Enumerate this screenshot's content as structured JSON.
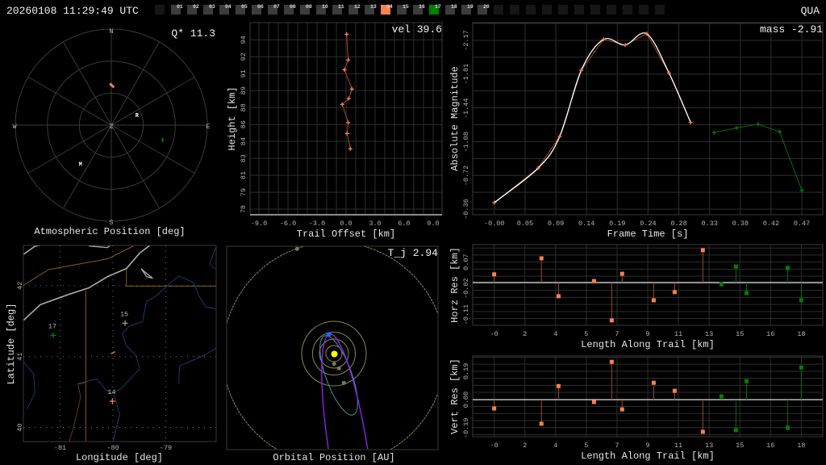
{
  "header": {
    "timestamp": "20260108 11:29:49 UTC",
    "station": "QUA"
  },
  "colors": {
    "primary": "#ff7f50",
    "secondary": "#008000",
    "grey_marker": "#9a9a9a",
    "fit": "#ffffff",
    "slot_idle": "#3c3c3c",
    "slot_off": "#161616"
  },
  "camera_slots": [
    {
      "label": "",
      "state": "off"
    },
    {
      "label": "01",
      "state": "idle"
    },
    {
      "label": "02",
      "state": "idle"
    },
    {
      "label": "03",
      "state": "idle"
    },
    {
      "label": "04",
      "state": "idle"
    },
    {
      "label": "05",
      "state": "idle"
    },
    {
      "label": "06",
      "state": "idle"
    },
    {
      "label": "07",
      "state": "idle"
    },
    {
      "label": "08",
      "state": "idle"
    },
    {
      "label": "09",
      "state": "idle"
    },
    {
      "label": "10",
      "state": "idle"
    },
    {
      "label": "11",
      "state": "idle"
    },
    {
      "label": "12",
      "state": "idle"
    },
    {
      "label": "13",
      "state": "idle"
    },
    {
      "label": "14",
      "state": "primary"
    },
    {
      "label": "15",
      "state": "idle"
    },
    {
      "label": "16",
      "state": "idle"
    },
    {
      "label": "17",
      "state": "secondary"
    },
    {
      "label": "18",
      "state": "idle"
    },
    {
      "label": "19",
      "state": "idle"
    },
    {
      "label": "20",
      "state": "idle"
    },
    {
      "label": "",
      "state": "off"
    },
    {
      "label": "",
      "state": "off"
    },
    {
      "label": "",
      "state": "off"
    },
    {
      "label": "",
      "state": "off"
    },
    {
      "label": "",
      "state": "off"
    },
    {
      "label": "",
      "state": "off"
    },
    {
      "label": "",
      "state": "off"
    },
    {
      "label": "",
      "state": "off"
    },
    {
      "label": "",
      "state": "off"
    },
    {
      "label": "",
      "state": "off"
    },
    {
      "label": "",
      "state": "off"
    }
  ],
  "polar": {
    "title": "Atmospheric Position [deg]",
    "stat": "Q* 11.3",
    "dirs": {
      "n": "N",
      "s": "S",
      "e": "E",
      "w": "W",
      "z": "Z"
    },
    "rings_deg": [
      30,
      60,
      90
    ],
    "markers": [
      {
        "label": "R",
        "az": 68,
        "zen": 26
      },
      {
        "label": "M",
        "az": 219,
        "zen": 46
      }
    ],
    "secondary_point": {
      "az": 106,
      "zen": 50
    },
    "primary_track": {
      "start": {
        "az": 358,
        "zen": 39
      },
      "end": {
        "az": 4,
        "zen": 35.5
      }
    }
  },
  "map": {
    "xlabel": "Longitude [deg]",
    "ylabel": "Latitude [deg]",
    "lon_ticks": {
      "values": [
        -81,
        -80,
        -79
      ],
      "labels": [
        "-81",
        "-80",
        "-79"
      ]
    },
    "lat_ticks": {
      "values": [
        42,
        41,
        40
      ],
      "labels": [
        "42",
        "41",
        "40"
      ]
    },
    "stations": [
      {
        "label": "17",
        "lon": -81.13,
        "lat": 41.3,
        "kind": "secondary"
      },
      {
        "label": "15",
        "lon": -79.77,
        "lat": 41.47,
        "kind": "grey"
      },
      {
        "label": "14",
        "lon": -80.01,
        "lat": 40.37,
        "kind": "primary"
      }
    ],
    "track": {
      "start": {
        "lon": -80.04,
        "lat": 41.04
      },
      "end": {
        "lon": -79.96,
        "lat": 41.07
      }
    }
  },
  "orbit": {
    "title": "Orbital Position [AU]",
    "stat": "T_j 2.94"
  },
  "chart_data": [
    {
      "id": "height",
      "type": "line",
      "stat": "vel 39.6",
      "xlabel": "Trail Offset [km]",
      "ylabel": "Height [km]",
      "xlim": [
        -9.92,
        9.92
      ],
      "ylim": [
        77.47,
        95.63
      ],
      "xticks": {
        "values": [
          -9,
          -6,
          -3,
          0,
          3,
          6,
          9
        ],
        "labels": [
          "-9.0",
          "-6.0",
          "-3.0",
          "0.0",
          "3.0",
          "6.0",
          "9.0"
        ]
      },
      "xgrid_step": 1,
      "yticks": {
        "values": [
          94.0,
          92.4,
          90.8,
          89.2,
          87.6,
          86.0,
          84.4,
          82.8,
          81.2,
          79.6,
          78.0
        ],
        "labels": [
          "94",
          "92",
          "91",
          "89",
          "88",
          "86",
          "84",
          "83",
          "81",
          "79",
          "78"
        ]
      },
      "series": [
        {
          "name": "14",
          "x": [
            0.06,
            0.22,
            -0.17,
            0.61,
            0.28,
            -0.39,
            0.22,
            0.11,
            0.44
          ],
          "y": [
            94.53,
            92.1,
            91.18,
            89.35,
            88.46,
            87.9,
            86.19,
            85.15,
            83.7
          ]
        }
      ]
    },
    {
      "id": "lightcurve",
      "type": "line",
      "stat": "mass -2.91",
      "xlabel": "Frame Time [s]",
      "ylabel": "Absolute Magnitude",
      "xlim": [
        -0.033,
        0.502
      ],
      "ylim": [
        -0.3,
        -2.36
      ],
      "xticks": {
        "values": [
          0,
          0.047,
          0.094,
          0.141,
          0.188,
          0.235,
          0.282,
          0.329,
          0.376,
          0.423,
          0.47
        ],
        "labels": [
          "-0.00",
          "0.05",
          "0.09",
          "0.14",
          "0.19",
          "0.24",
          "0.28",
          "0.33",
          "0.38",
          "0.42",
          "0.47"
        ]
      },
      "yticks": {
        "values": [
          -2.17,
          -1.81,
          -1.44,
          -1.08,
          -0.72,
          -0.36
        ],
        "labels": [
          "-2.17",
          "-1.81",
          "-1.44",
          "-1.08",
          "-0.72",
          "-0.36"
        ]
      },
      "ygrid_step": 0.181,
      "series": [
        {
          "name": "14",
          "x": [
            0,
            0.067,
            0.1,
            0.133,
            0.167,
            0.2,
            0.233,
            0.267,
            0.3
          ],
          "y": [
            -0.43,
            -0.8,
            -1.14,
            -1.85,
            -2.18,
            -2.12,
            -2.24,
            -1.82,
            -1.29
          ]
        },
        {
          "name": "17",
          "x": [
            0.336,
            0.37,
            0.403,
            0.436,
            0.47
          ],
          "y": [
            -1.18,
            -1.23,
            -1.27,
            -1.19,
            -0.56
          ]
        }
      ],
      "fit": {
        "name": "fit",
        "source": "14"
      }
    },
    {
      "id": "horz_res",
      "type": "scatter",
      "xlabel": "Length Along Trail [km]",
      "ylabel": "Horz Res [km]",
      "xlim": [
        -1.26,
        19.26
      ],
      "ylim": [
        -0.147,
        0.13
      ],
      "xticks": {
        "values": [
          0,
          1.8,
          3.6,
          5.4,
          7.2,
          9,
          10.8,
          12.6,
          14.4,
          16.2,
          18
        ],
        "labels": [
          "-0",
          "2",
          "4",
          "5",
          "7",
          "9",
          "11",
          "13",
          "15",
          "16",
          "18"
        ]
      },
      "yticks": {
        "values": [
          0.07,
          -0.02,
          -0.11
        ],
        "labels": [
          "0.07",
          "-0.02",
          "-0.11"
        ]
      },
      "ygrid_step": 0.0242,
      "series": [
        {
          "name": "14",
          "x": [
            0,
            2.77,
            3.77,
            5.85,
            6.89,
            7.5,
            9.35,
            10.58,
            12.23
          ],
          "y": [
            0.028,
            0.083,
            -0.047,
            0.005,
            -0.13,
            0.03,
            -0.061,
            -0.033,
            0.111
          ]
        },
        {
          "name": "17",
          "x": [
            13.32,
            14.17,
            14.79,
            17.2,
            18.0
          ],
          "y": [
            -0.006,
            0.055,
            -0.036,
            0.05,
            -0.061
          ]
        }
      ]
    },
    {
      "id": "vert_res",
      "type": "scatter",
      "xlabel": "Length Along Trail [km]",
      "ylabel": "Vert Res [km]",
      "xlim": [
        -1.26,
        19.26
      ],
      "ylim": [
        -0.248,
        0.292
      ],
      "xticks": {
        "values": [
          0,
          1.8,
          3.6,
          5.4,
          7.2,
          9,
          10.8,
          12.6,
          14.4,
          16.2,
          18
        ],
        "labels": [
          "-0",
          "2",
          "4",
          "5",
          "7",
          "9",
          "11",
          "13",
          "15",
          "16",
          "18"
        ]
      },
      "yticks": {
        "values": [
          0.19,
          0.0,
          -0.19
        ],
        "labels": [
          "0.19",
          "0.00",
          "-0.19"
        ]
      },
      "ygrid_step": 0.0471,
      "series": [
        {
          "name": "14",
          "x": [
            0,
            2.77,
            3.77,
            5.85,
            6.89,
            7.5,
            9.35,
            10.58,
            12.23
          ],
          "y": [
            -0.059,
            -0.161,
            0.091,
            -0.016,
            0.253,
            -0.065,
            0.113,
            0.059,
            -0.215
          ]
        },
        {
          "name": "17",
          "x": [
            13.32,
            14.17,
            14.79,
            17.2,
            18.0
          ],
          "y": [
            0.022,
            -0.204,
            0.124,
            -0.188,
            0.215
          ]
        }
      ]
    }
  ]
}
